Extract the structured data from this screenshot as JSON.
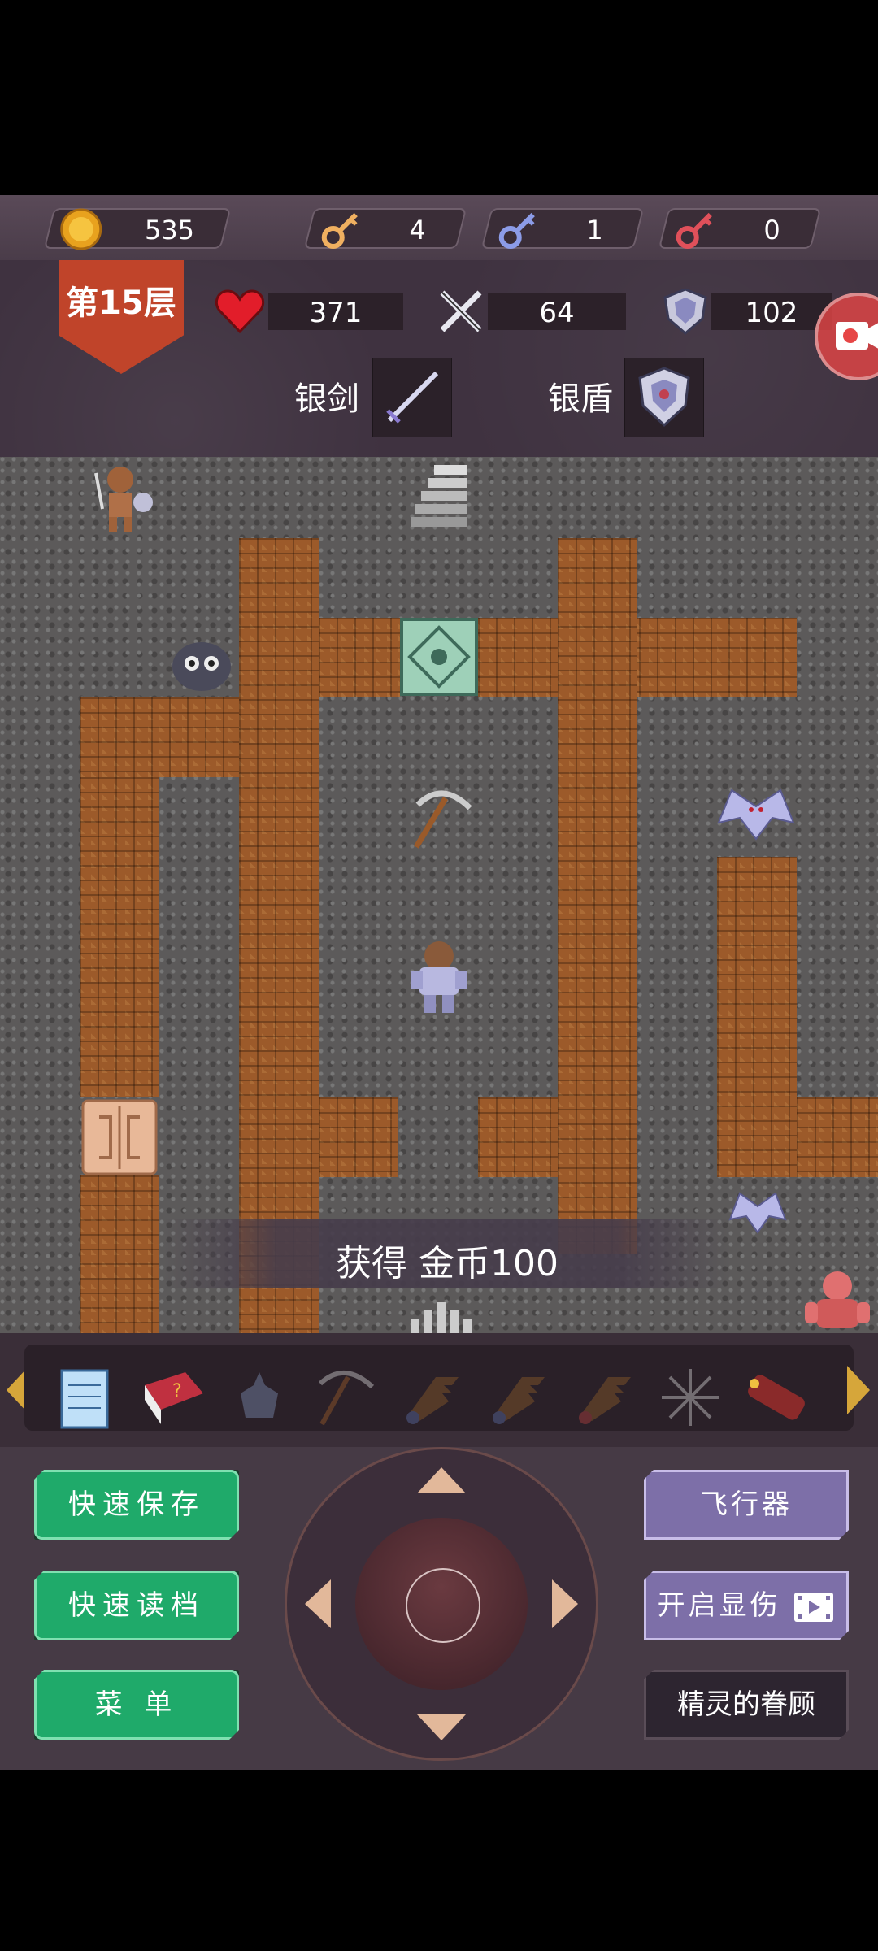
{
  "resources": {
    "gold": "535",
    "yellow_keys": "4",
    "blue_keys": "1",
    "red_keys": "0"
  },
  "status": {
    "floor": "第15层",
    "hp": "371",
    "attack": "64",
    "defense": "102"
  },
  "equipment": {
    "weapon_label": "银剑",
    "armor_label": "银盾"
  },
  "toast": "获得 金币100",
  "items": [
    "notepad-icon",
    "monster-book-icon",
    "holy-water-icon",
    "pickaxe-icon",
    "fly-up-icon",
    "fly-down-icon",
    "fly-wing-icon",
    "snowflake-icon",
    "bomb-icon"
  ],
  "buttons": {
    "quick_save": "快速保存",
    "quick_load": "快速读档",
    "menu": "菜 单",
    "flyer": "飞行器",
    "show_damage": "开启显伤",
    "fairy_blessing": "精灵的眷顾"
  },
  "colors": {
    "green_button": "#1faa6a",
    "purple_button": "#7d6fa8",
    "floor_badge": "#c0442a",
    "wall": "#9c5a2a"
  }
}
